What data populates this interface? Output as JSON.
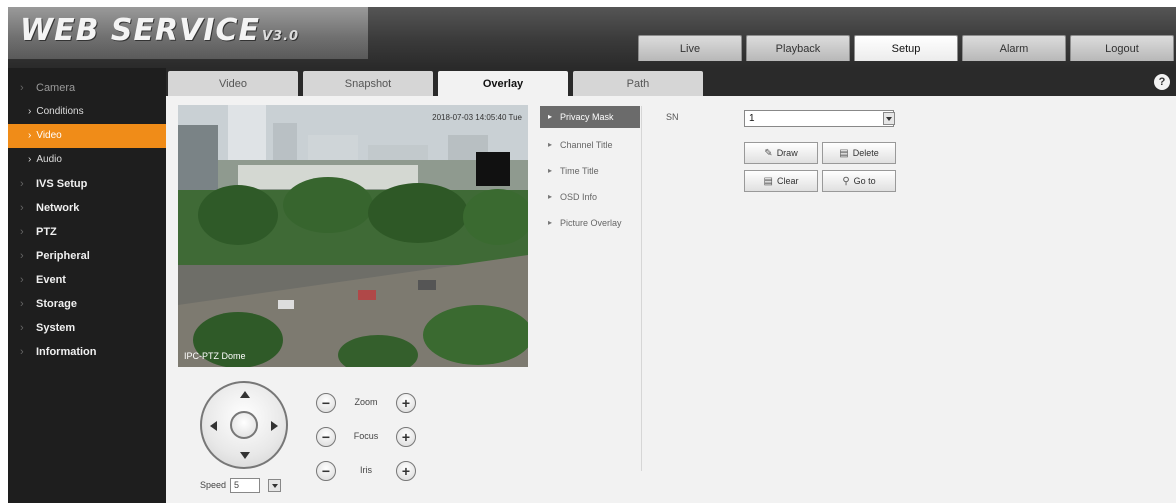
{
  "header": {
    "logo": "WEB SERVICE",
    "version": "V3.0",
    "nav": [
      "Live",
      "Playback",
      "Setup",
      "Alarm",
      "Logout"
    ],
    "active_nav": "Setup"
  },
  "sidebar": {
    "camera": "Camera",
    "sub_items": [
      {
        "label": "Conditions"
      },
      {
        "label": "Video"
      },
      {
        "label": "Audio"
      }
    ],
    "items": [
      "IVS Setup",
      "Network",
      "PTZ",
      "Peripheral",
      "Event",
      "Storage",
      "System",
      "Information"
    ]
  },
  "subtabs": [
    "Video",
    "Snapshot",
    "Overlay",
    "Path"
  ],
  "active_subtab": "Overlay",
  "help_icon": "?",
  "video": {
    "timestamp": "2018-07-03 14:05:40 Tue",
    "channel_label": "IPC-PTZ Dome"
  },
  "ptz": {
    "zoom_label": "Zoom",
    "focus_label": "Focus",
    "iris_label": "Iris",
    "speed_label": "Speed",
    "speed_value": "5"
  },
  "overlay_menu": {
    "items": [
      "Privacy Mask",
      "Channel Title",
      "Time Title",
      "OSD Info",
      "Picture Overlay"
    ],
    "active": "Privacy Mask"
  },
  "privacy": {
    "sn_label": "SN",
    "sn_value": "1",
    "buttons": {
      "draw": "Draw",
      "delete": "Delete",
      "clear": "Clear",
      "goto": "Go to"
    }
  }
}
